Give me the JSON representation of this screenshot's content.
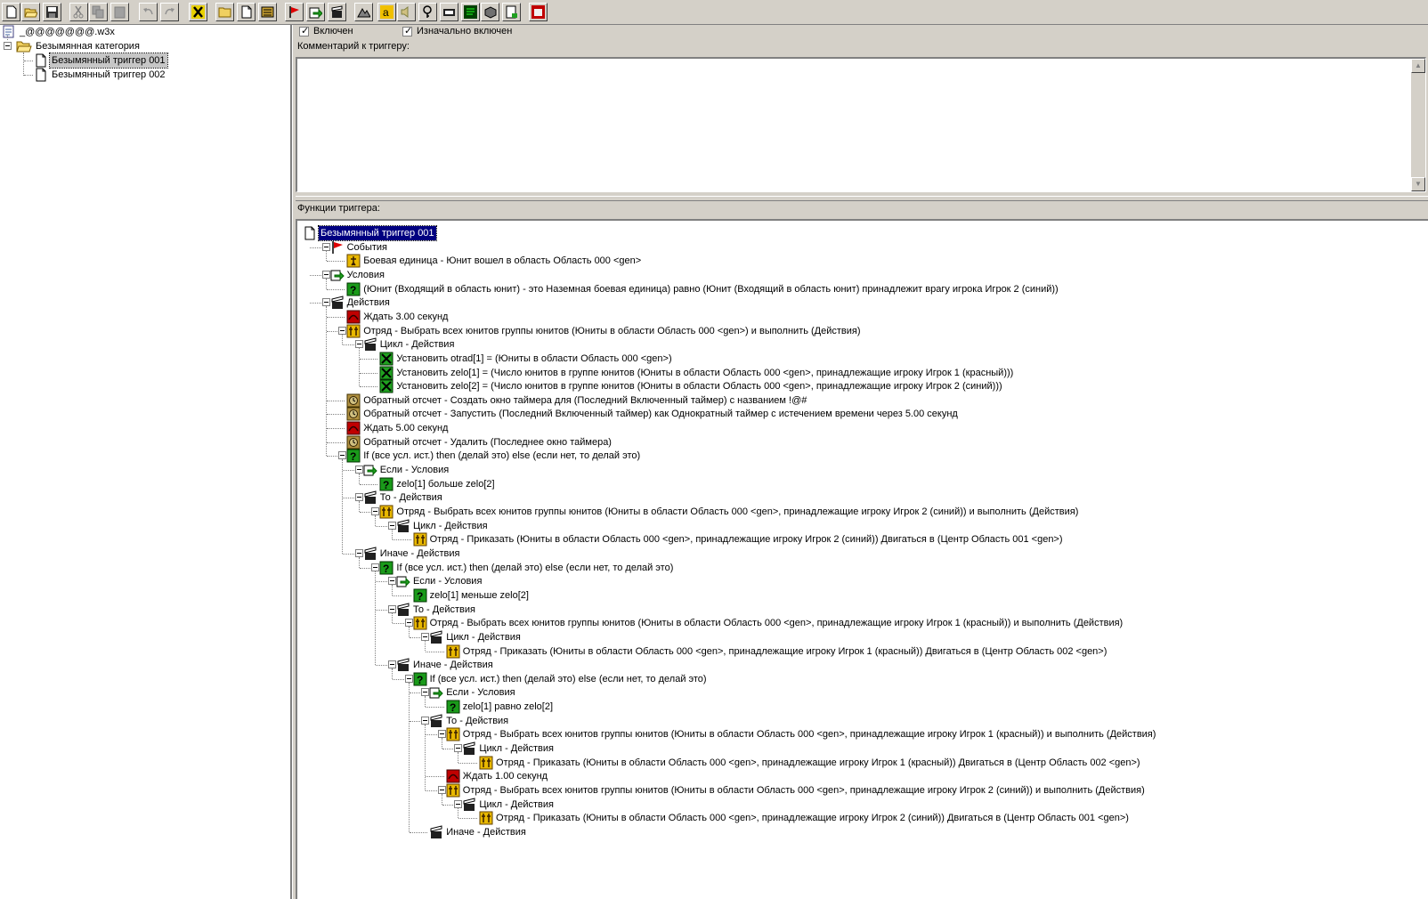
{
  "toolbar": {
    "buttons": [
      "new-file",
      "open-folder",
      "save",
      "cut",
      "copy",
      "paste",
      "undo",
      "redo",
      "x-tool",
      "new-category",
      "new-trigger",
      "new-comment",
      "red-flag",
      "green-arrow",
      "clapper",
      "terrain",
      "text-a",
      "sound",
      "key",
      "import",
      "monitor",
      "object",
      "page-edit",
      "exit"
    ]
  },
  "left_tree": {
    "root": "_@@@@@@@.w3x",
    "category": "Безымянная категория",
    "triggers": [
      "Безымянный триггер 001",
      "Безымянный триггер 002"
    ]
  },
  "props": {
    "enabled_label": "Включен",
    "initially_enabled_label": "Изначально включен",
    "comment_label": "Комментарий к триггеру:",
    "functions_label": "Функции триггера:"
  },
  "functions": [
    {
      "d": 0,
      "t": "Безымянный триггер 001",
      "ic": "trigger",
      "exp": false,
      "sel": true
    },
    {
      "d": 1,
      "t": "События",
      "ic": "event",
      "exp": true
    },
    {
      "d": 2,
      "t": "Боевая единица - Юнит вошел в область Область 000 <gen>",
      "ic": "unit"
    },
    {
      "d": 1,
      "t": "Условия",
      "ic": "cond",
      "exp": true
    },
    {
      "d": 2,
      "t": "(Юнит (Входящий в область юнит) - это Наземная боевая единица) равно (Юнит (Входящий в область юнит) принадлежит врагу игрока Игрок 2 (синий))",
      "ic": "q"
    },
    {
      "d": 1,
      "t": "Действия",
      "ic": "action",
      "exp": true
    },
    {
      "d": 2,
      "t": "Ждать 3.00 секунд",
      "ic": "wait"
    },
    {
      "d": 2,
      "t": "Отряд - Выбрать всех юнитов группы юнитов (Юниты в области Область 000 <gen>) и выполнить (Действия)",
      "ic": "group",
      "exp": true
    },
    {
      "d": 3,
      "t": "Цикл - Действия",
      "ic": "action",
      "exp": true
    },
    {
      "d": 4,
      "t": "Установить otrad[1] = (Юниты в области Область 000 <gen>)",
      "ic": "set"
    },
    {
      "d": 4,
      "t": "Установить zelo[1] = (Число юнитов в группе юнитов (Юниты в области Область 000 <gen>, принадлежащие игроку Игрок 1 (красный)))",
      "ic": "set"
    },
    {
      "d": 4,
      "t": "Установить zelo[2] = (Число юнитов в группе юнитов (Юниты в области Область 000 <gen>, принадлежащие игроку Игрок 2 (синий)))",
      "ic": "set"
    },
    {
      "d": 2,
      "t": "Обратный отсчет - Создать окно таймера для (Последний Включенный таймер) с названием !@#",
      "ic": "timer"
    },
    {
      "d": 2,
      "t": "Обратный отсчет - Запустить (Последний Включенный таймер) как Однократный таймер с истечением времени через 5.00 секунд",
      "ic": "timer"
    },
    {
      "d": 2,
      "t": "Ждать 5.00 секунд",
      "ic": "wait"
    },
    {
      "d": 2,
      "t": "Обратный отсчет - Удалить (Последнее окно таймера)",
      "ic": "timer"
    },
    {
      "d": 2,
      "t": "If (все усл. ист.) then (делай это) else (если нет, то делай это)",
      "ic": "q",
      "exp": true
    },
    {
      "d": 3,
      "t": "Если - Условия",
      "ic": "cond",
      "exp": true
    },
    {
      "d": 4,
      "t": "zelo[1] больше zelo[2]",
      "ic": "q"
    },
    {
      "d": 3,
      "t": "То - Действия",
      "ic": "action",
      "exp": true
    },
    {
      "d": 4,
      "t": "Отряд - Выбрать всех юнитов группы юнитов (Юниты в области Область 000 <gen>, принадлежащие игроку Игрок 2 (синий)) и выполнить (Действия)",
      "ic": "group",
      "exp": true
    },
    {
      "d": 5,
      "t": "Цикл - Действия",
      "ic": "action",
      "exp": true
    },
    {
      "d": 6,
      "t": "Отряд - Приказать (Юниты в области Область 000 <gen>, принадлежащие игроку Игрок 2 (синий)) Двигаться в (Центр Область 001 <gen>)",
      "ic": "group"
    },
    {
      "d": 3,
      "t": "Иначе - Действия",
      "ic": "action",
      "exp": true
    },
    {
      "d": 4,
      "t": "If (все усл. ист.) then (делай это) else (если нет, то делай это)",
      "ic": "q",
      "exp": true
    },
    {
      "d": 5,
      "t": "Если - Условия",
      "ic": "cond",
      "exp": true
    },
    {
      "d": 6,
      "t": "zelo[1] меньше zelo[2]",
      "ic": "q"
    },
    {
      "d": 5,
      "t": "То - Действия",
      "ic": "action",
      "exp": true
    },
    {
      "d": 6,
      "t": "Отряд - Выбрать всех юнитов группы юнитов (Юниты в области Область 000 <gen>, принадлежащие игроку Игрок 1 (красный)) и выполнить (Действия)",
      "ic": "group",
      "exp": true
    },
    {
      "d": 7,
      "t": "Цикл - Действия",
      "ic": "action",
      "exp": true
    },
    {
      "d": 8,
      "t": "Отряд - Приказать (Юниты в области Область 000 <gen>, принадлежащие игроку Игрок 1 (красный)) Двигаться в (Центр Область 002 <gen>)",
      "ic": "group"
    },
    {
      "d": 5,
      "t": "Иначе - Действия",
      "ic": "action",
      "exp": true
    },
    {
      "d": 6,
      "t": "If (все усл. ист.) then (делай это) else (если нет, то делай это)",
      "ic": "q",
      "exp": true
    },
    {
      "d": 7,
      "t": "Если - Условия",
      "ic": "cond",
      "exp": true
    },
    {
      "d": 8,
      "t": "zelo[1] равно zelo[2]",
      "ic": "q"
    },
    {
      "d": 7,
      "t": "То - Действия",
      "ic": "action",
      "exp": true
    },
    {
      "d": 8,
      "t": "Отряд - Выбрать всех юнитов группы юнитов (Юниты в области Область 000 <gen>, принадлежащие игроку Игрок 1 (красный)) и выполнить (Действия)",
      "ic": "group",
      "exp": true
    },
    {
      "d": 9,
      "t": "Цикл - Действия",
      "ic": "action",
      "exp": true
    },
    {
      "d": 10,
      "t": "Отряд - Приказать (Юниты в области Область 000 <gen>, принадлежащие игроку Игрок 1 (красный)) Двигаться в (Центр Область 002 <gen>)",
      "ic": "group"
    },
    {
      "d": 8,
      "t": "Ждать 1.00 секунд",
      "ic": "wait"
    },
    {
      "d": 8,
      "t": "Отряд - Выбрать всех юнитов группы юнитов (Юниты в области Область 000 <gen>, принадлежащие игроку Игрок 2 (синий)) и выполнить (Действия)",
      "ic": "group",
      "exp": true
    },
    {
      "d": 9,
      "t": "Цикл - Действия",
      "ic": "action",
      "exp": true
    },
    {
      "d": 10,
      "t": "Отряд - Приказать (Юниты в области Область 000 <gen>, принадлежащие игроку Игрок 2 (синий)) Двигаться в (Центр Область 001 <gen>)",
      "ic": "group"
    },
    {
      "d": 7,
      "t": "Иначе - Действия",
      "ic": "action"
    }
  ],
  "colors": {
    "selection": "#000080",
    "icon_yellow": "#f0c000",
    "icon_green": "#1a9a1a",
    "icon_red": "#cc0000"
  }
}
